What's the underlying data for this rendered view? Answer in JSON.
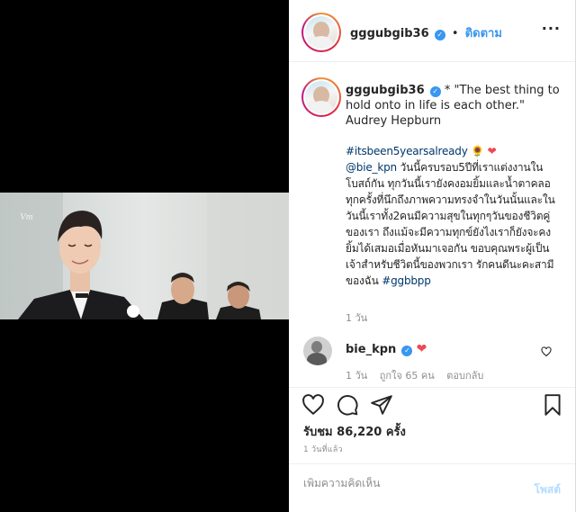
{
  "header": {
    "username": "gggubgib36",
    "separator": "•",
    "follow_label": "ติดตาม"
  },
  "caption": {
    "username": "gggubgib36",
    "quote": "* \"The best thing to hold onto in life is each other.\" Audrey Hepburn",
    "hashtag": "#itsbeen5yearsalready",
    "mention": "@bie_kpn",
    "body": "วันนี้ครบรอบ5ปีที่เราแต่งงานในโบสถ์กัน ทุกวันนี้เรายังคงอมยิ้มและน้ำตาคลอทุกครั้งที่นึกถึงภาพความทรงจำในวันนั้นและในวันนี้เราทั้ง2คนมีความสุขในทุกๆวันของชีวิตคู่ของเรา ถึงแม้จะมีความทุกข์ยังไงเราก็ยังจะคงยิ้มได้เสมอเมื่อหันมาเจอกัน ขอบคุณพระผู้เป็นเจ้าสำหรับชีวิตนี้ของพวกเรา รักคนดีนะคะสามีของฉัน",
    "end_hashtag": "#ggbbpp",
    "emoji_sunflower": "🌻",
    "emoji_heart": "❤",
    "time": "1 วัน"
  },
  "comment": {
    "username": "bie_kpn",
    "emoji_heart": "❤",
    "time": "1 วัน",
    "likes": "ถูกใจ 65 คน",
    "reply_label": "ตอบกลับ"
  },
  "stats": {
    "views": "รับชม 86,220 ครั้ง",
    "time_ago": "1 วันที่แล้ว"
  },
  "composer": {
    "placeholder": "เพิ่มความคิดเห็น",
    "post_label": "โพสต์"
  },
  "media": {
    "watermark": "Vm"
  },
  "colors": {
    "accent": "#3897f0",
    "like_red": "#ed4956",
    "link": "#00376b",
    "muted": "#8e8e8e"
  },
  "icons": {
    "like": "heart-outline-icon",
    "comment": "comment-bubble-icon",
    "share": "paper-plane-icon",
    "save": "bookmark-icon",
    "comment_like": "small-heart-outline-icon"
  }
}
